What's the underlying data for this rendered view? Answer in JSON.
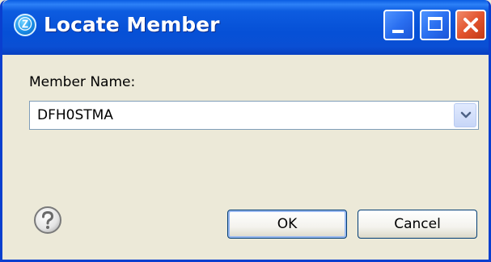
{
  "window": {
    "title": "Locate Member",
    "app_icon_glyph": "Ⓩ",
    "app_icon_name": "app-logo-icon",
    "controls": {
      "minimize": "minimize-icon",
      "maximize": "maximize-icon",
      "close": "close-icon"
    }
  },
  "form": {
    "member_name_label": "Member Name:",
    "member_name_value": "DFH0STMA",
    "dropdown_icon": "chevron-down-icon"
  },
  "footer": {
    "help_icon": "help-icon",
    "ok_label": "OK",
    "cancel_label": "Cancel"
  },
  "colors": {
    "titlebar": "#0a5de3",
    "dialog_bg": "#ece9d8",
    "close_button": "#e2542e"
  }
}
